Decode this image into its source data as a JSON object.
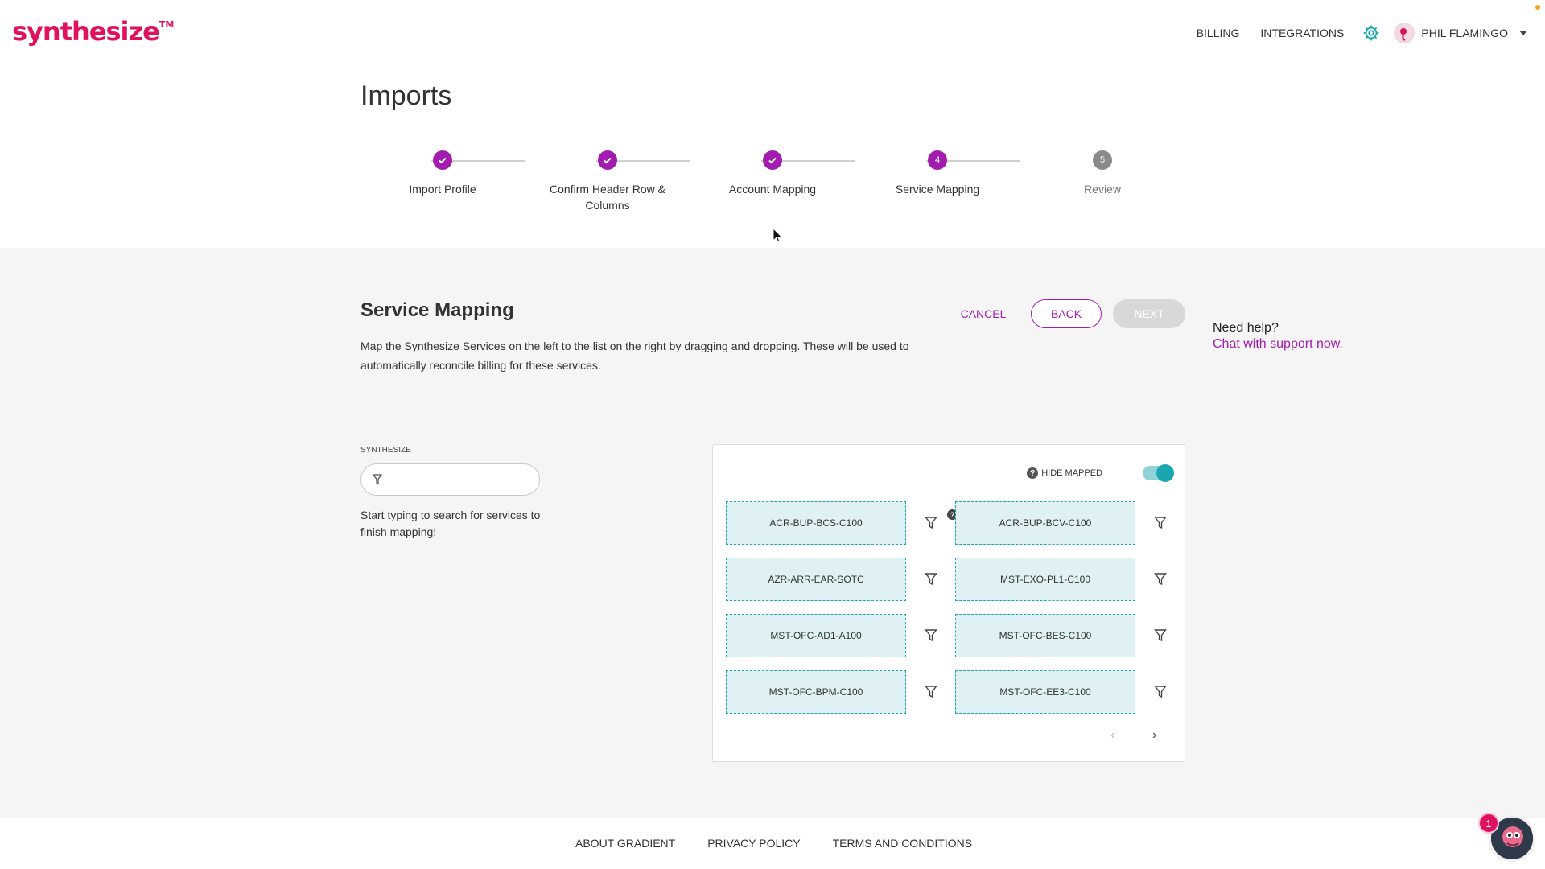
{
  "header": {
    "logo": "synthesize",
    "logo_tm": "TM",
    "nav": {
      "billing": "BILLING",
      "integrations": "INTEGRATIONS",
      "settings_icon": "gear-icon",
      "user_name": "PHIL FLAMINGO"
    }
  },
  "page_title": "Imports",
  "stepper": {
    "steps": [
      {
        "label": "Import Profile",
        "status": "done"
      },
      {
        "label": "Confirm Header Row & Columns",
        "status": "done"
      },
      {
        "label": "Account Mapping",
        "status": "done"
      },
      {
        "label": "Service Mapping",
        "status": "active",
        "number": "4"
      },
      {
        "label": "Review",
        "status": "pending",
        "number": "5"
      }
    ]
  },
  "section": {
    "title": "Service Mapping",
    "description": "Map the Synthesize Services on the left to the list on the right by dragging and dropping. These will be used to automatically reconcile billing for these services.",
    "cancel": "CANCEL",
    "back": "BACK",
    "next": "NEXT"
  },
  "help": {
    "question": "Need help?",
    "chat_link": "Chat with support now."
  },
  "synthesize_search": {
    "label": "SYNTHESIZE",
    "value": "",
    "hint": "Start typing to search for services to finish mapping!"
  },
  "mapping_panel": {
    "hide_mapped_label": "HIDE MAPPED",
    "hide_mapped_enabled": true,
    "rows": [
      {
        "left": "ACR-BUP-BCS-C100",
        "right": "ACR-BUP-BCV-C100"
      },
      {
        "left": "AZR-ARR-EAR-SOTC",
        "right": "MST-EXO-PL1-C100"
      },
      {
        "left": "MST-OFC-AD1-A100",
        "right": "MST-OFC-BES-C100"
      },
      {
        "left": "MST-OFC-BPM-C100",
        "right": "MST-OFC-EE3-C100"
      }
    ],
    "pager_prev": "‹",
    "pager_next": "›"
  },
  "footer": {
    "about": "ABOUT GRADIENT",
    "privacy": "PRIVACY POLICY",
    "terms": "TERMS AND CONDITIONS"
  },
  "chat_widget": {
    "badge_count": "1"
  },
  "colors": {
    "brand": "#e0115f",
    "accent": "#a21caf",
    "teal": "#1aa6b0"
  }
}
